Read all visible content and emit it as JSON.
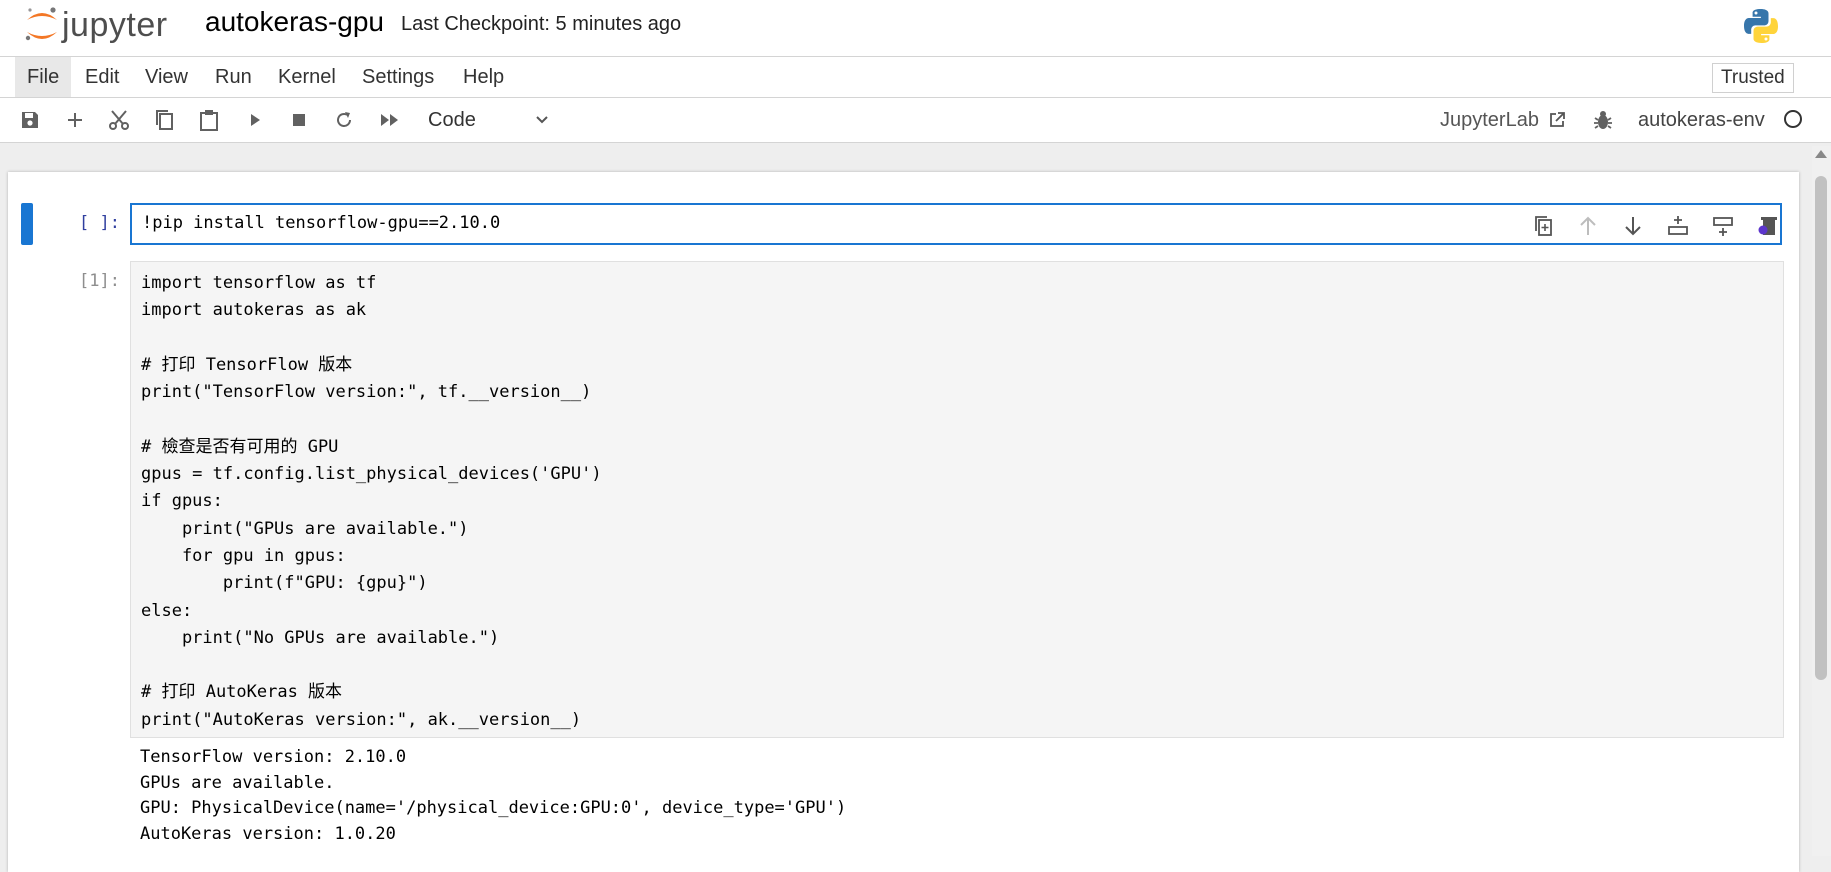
{
  "header": {
    "logo_text": "jupyter",
    "notebook_title": "autokeras-gpu",
    "checkpoint": "Last Checkpoint: 5 minutes ago"
  },
  "menu": {
    "items": [
      "File",
      "Edit",
      "View",
      "Run",
      "Kernel",
      "Settings",
      "Help"
    ],
    "trusted": "Trusted"
  },
  "toolbar": {
    "cell_type": "Code",
    "jupyterlab_link": "JupyterLab",
    "kernel_name": "autokeras-env",
    "icons": [
      "save-icon",
      "add-icon",
      "cut-icon",
      "copy-icon",
      "paste-icon",
      "run-icon",
      "stop-icon",
      "restart-icon",
      "fast-forward-icon"
    ]
  },
  "cells": [
    {
      "prompt": "[ ]:",
      "source": "!pip install tensorflow-gpu==2.10.0",
      "active": true
    },
    {
      "prompt": "[1]:",
      "source": "import tensorflow as tf\nimport autokeras as ak\n\n# 打印 TensorFlow 版本\nprint(\"TensorFlow version:\", tf.__version__)\n\n# 檢查是否有可用的 GPU\ngpus = tf.config.list_physical_devices('GPU')\nif gpus:\n    print(\"GPUs are available.\")\n    for gpu in gpus:\n        print(f\"GPU: {gpu}\")\nelse:\n    print(\"No GPUs are available.\")\n\n# 打印 AutoKeras 版本\nprint(\"AutoKeras version:\", ak.__version__)",
      "output": "TensorFlow version: 2.10.0\nGPUs are available.\nGPU: PhysicalDevice(name='/physical_device:GPU:0', device_type='GPU')\nAutoKeras version: 1.0.20"
    }
  ],
  "colors": {
    "accent": "#1976d2",
    "jupyter_orange": "#F37726",
    "python_blue": "#3776AB",
    "python_yellow": "#FFD43B"
  }
}
